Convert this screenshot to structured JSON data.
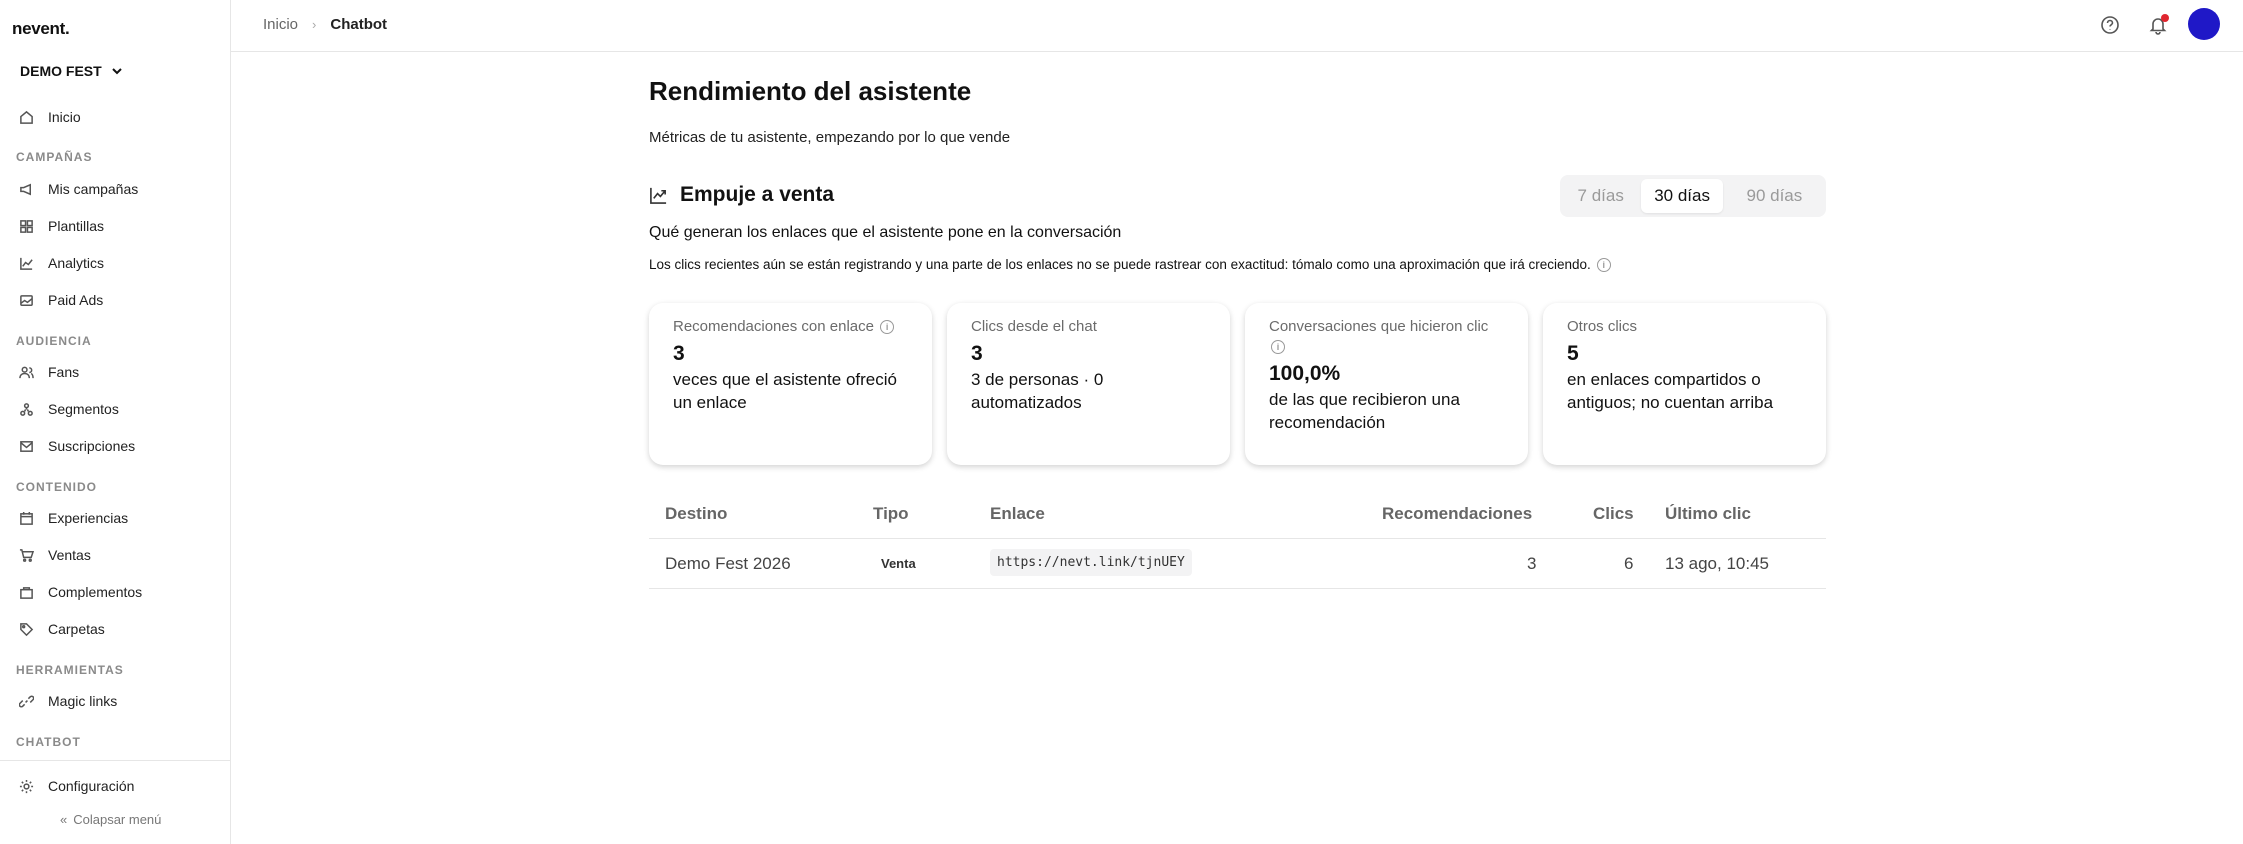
{
  "app": {
    "logo": "nevent."
  },
  "sidebar": {
    "org": "DEMO FEST",
    "home": "Inicio",
    "sections": {
      "campaigns": "CAMPAÑAS",
      "audience": "AUDIENCIA",
      "content": "CONTENIDO",
      "tools": "HERRAMIENTAS",
      "chatbot": "CHATBOT"
    },
    "items": {
      "campaigns": "Mis campañas",
      "templates": "Plantillas",
      "analytics": "Analytics",
      "paid_ads": "Paid Ads",
      "fans": "Fans",
      "segments": "Segmentos",
      "subscriptions": "Suscripciones",
      "experiences": "Experiencias",
      "sales": "Ventas",
      "addons": "Complementos",
      "folders": "Carpetas",
      "magic_links": "Magic links",
      "settings": "Configuración"
    },
    "collapse": "Colapsar menú"
  },
  "header": {
    "breadcrumb": [
      "Inicio",
      "Chatbot"
    ],
    "avatar_color": "#1f18c7"
  },
  "main": {
    "title": "Rendimiento del asistente",
    "subtitle": "Métricas de tu asistente, empezando por lo que vende",
    "section_title": "Empuje a venta",
    "ranges": [
      "7 días",
      "30 días",
      "90 días"
    ],
    "selected_range": "30 días",
    "description": "Qué generan los enlaces que el asistente pone en la conversación",
    "note": "Los clics recientes aún se están registrando y una parte de los enlaces no se puede rastrear con exactitud: tómalo como una aproximación que irá creciendo.",
    "cards": [
      {
        "label": "Recomendaciones con enlace",
        "value": "3",
        "sub": "veces que el asistente ofreció un enlace"
      },
      {
        "label": "Clics desde el chat",
        "value": "3",
        "sub": "3 de personas · 0 automatizados"
      },
      {
        "label": "Conversaciones que hicieron clic",
        "value": "100,0%",
        "sub": "de las que recibieron una recomendación"
      },
      {
        "label": "Otros clics",
        "value": "5",
        "sub": "en enlaces compartidos o antiguos; no cuentan arriba"
      }
    ],
    "table": {
      "headers": [
        "Destino",
        "Tipo",
        "Enlace",
        "Recomendaciones",
        "Clics",
        "Último clic"
      ],
      "rows": [
        {
          "destination": "Demo Fest 2026",
          "type": "Venta",
          "link": "https://nevt.link/tjnUEY",
          "recommendations": "3",
          "clicks": "6",
          "last_click": "13 ago, 10:45"
        }
      ]
    }
  }
}
